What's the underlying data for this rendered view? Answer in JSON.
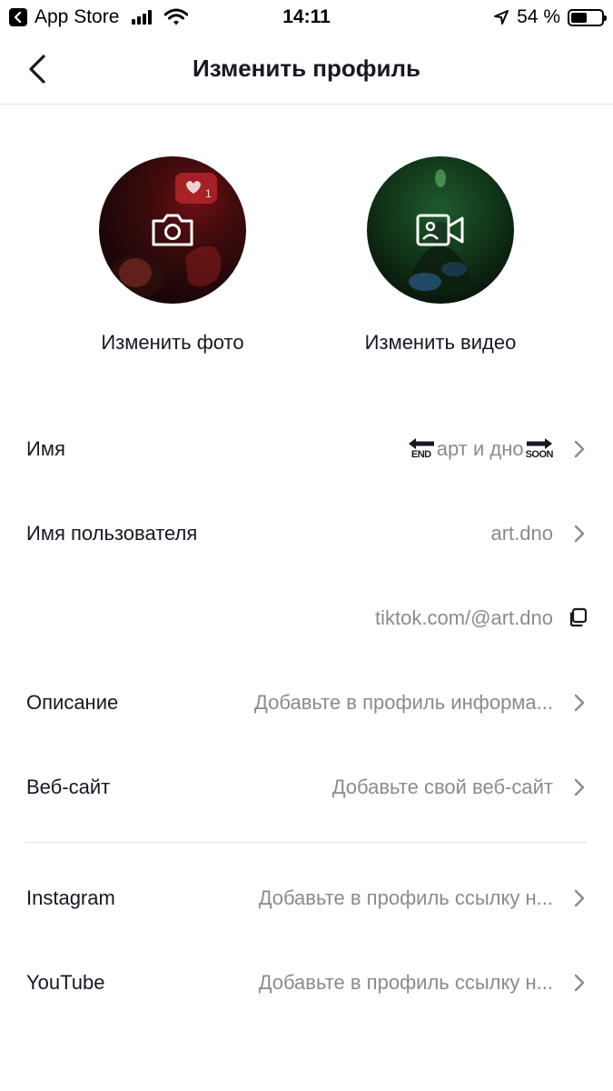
{
  "status_bar": {
    "back_app_label": "App Store",
    "time": "14:11",
    "battery": "54 %",
    "battery_level": 0.54
  },
  "nav": {
    "title": "Изменить профиль",
    "back_icon": "chevron-left-icon"
  },
  "media": {
    "photo_label": "Изменить фото",
    "video_label": "Изменить видео",
    "photo_icon": "camera-icon",
    "video_icon": "video-camera-icon",
    "photo_badge_count": "1"
  },
  "rows": {
    "name": {
      "label": "Имя",
      "value": "арт и дно",
      "prefix_tag": "END",
      "suffix_tag": "SOON"
    },
    "username": {
      "label": "Имя пользователя",
      "value": "art.dno"
    },
    "link": {
      "value": "tiktok.com/@art.dno"
    },
    "bio": {
      "label": "Описание",
      "value": "Добавьте в профиль информа..."
    },
    "website": {
      "label": "Веб-сайт",
      "value": "Добавьте свой веб-сайт"
    },
    "instagram": {
      "label": "Instagram",
      "value": "Добавьте в профиль ссылку н..."
    },
    "youtube": {
      "label": "YouTube",
      "value": "Добавьте в профиль ссылку н..."
    }
  },
  "colors": {
    "text_primary": "#161823",
    "text_secondary": "#8a8b91",
    "divider": "#e3e3e4"
  }
}
